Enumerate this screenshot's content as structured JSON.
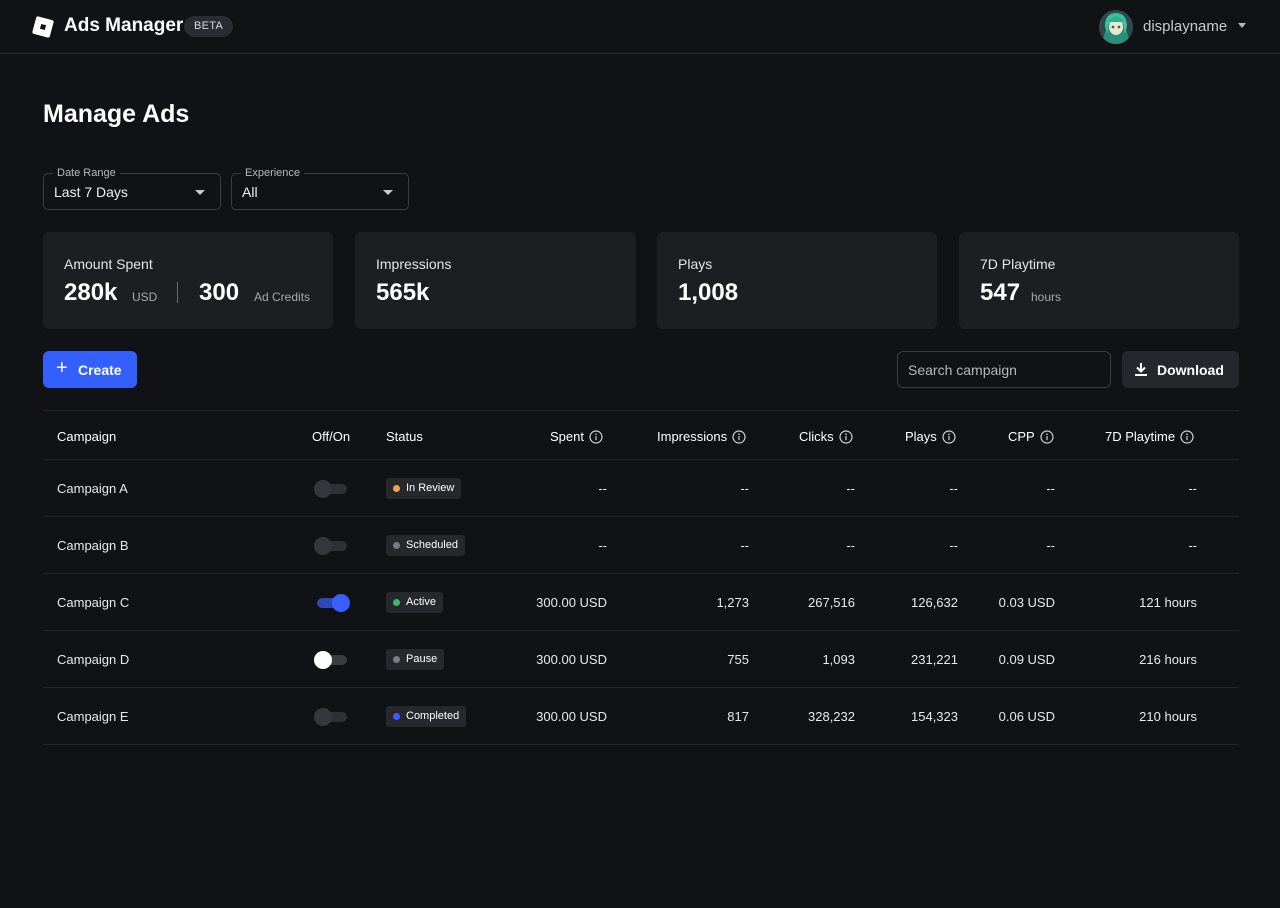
{
  "header": {
    "app_title": "Ads Manager",
    "beta_label": "BETA",
    "username": "displayname",
    "logo_icon": "roblox-logo-icon",
    "avatar_icon": "user-avatar"
  },
  "page": {
    "title": "Manage Ads"
  },
  "filters": {
    "date_range": {
      "label": "Date Range",
      "value": "Last 7 Days"
    },
    "experience": {
      "label": "Experience",
      "value": "All"
    }
  },
  "stats": {
    "amount_spent": {
      "label": "Amount Spent",
      "value": "280k",
      "unit": "USD",
      "credits_value": "300",
      "credits_unit": "Ad Credits"
    },
    "impressions": {
      "label": "Impressions",
      "value": "565k"
    },
    "plays": {
      "label": "Plays",
      "value": "1,008"
    },
    "playtime": {
      "label": "7D Playtime",
      "value": "547",
      "unit": "hours"
    }
  },
  "actions": {
    "create_label": "Create",
    "search_placeholder": "Search campaign",
    "download_label": "Download"
  },
  "table": {
    "columns": [
      "Campaign",
      "Off/On",
      "Status",
      "Spent",
      "Impressions",
      "Clicks",
      "Plays",
      "CPP",
      "7D Playtime"
    ],
    "rows": [
      {
        "campaign": "Campaign A",
        "enabled": false,
        "toggle_style": "off",
        "status": "In Review",
        "status_color": "#f0a646",
        "spent": "--",
        "impressions": "--",
        "clicks": "--",
        "plays": "--",
        "cpp": "--",
        "playtime": "--"
      },
      {
        "campaign": "Campaign B",
        "enabled": false,
        "toggle_style": "off",
        "status": "Scheduled",
        "status_color": "#7a7d83",
        "spent": "--",
        "impressions": "--",
        "clicks": "--",
        "plays": "--",
        "cpp": "--",
        "playtime": "--"
      },
      {
        "campaign": "Campaign C",
        "enabled": true,
        "toggle_style": "on",
        "status": "Active",
        "status_color": "#3dbb6b",
        "spent": "300.00 USD",
        "impressions": "1,273",
        "clicks": "267,516",
        "plays": "126,632",
        "cpp": "0.03 USD",
        "playtime": "121 hours"
      },
      {
        "campaign": "Campaign D",
        "enabled": false,
        "toggle_style": "off-white",
        "status": "Pause",
        "status_color": "#7a7d83",
        "spent": "300.00 USD",
        "impressions": "755",
        "clicks": "1,093",
        "plays": "231,221",
        "cpp": "0.09 USD",
        "playtime": "216 hours"
      },
      {
        "campaign": "Campaign E",
        "enabled": false,
        "toggle_style": "off",
        "status": "Completed",
        "status_color": "#3d5bff",
        "spent": "300.00 USD",
        "impressions": "817",
        "clicks": "328,232",
        "plays": "154,323",
        "cpp": "0.06 USD",
        "playtime": "210 hours"
      }
    ]
  },
  "colors": {
    "background": "#111216",
    "card": "#1d1e22",
    "accent": "#335fff"
  }
}
